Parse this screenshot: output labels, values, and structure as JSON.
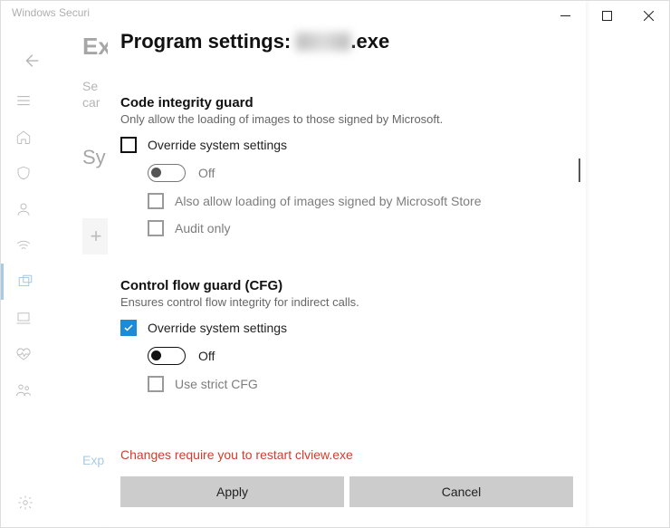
{
  "bg": {
    "appTitle": "Windows Securi",
    "heading": "Ex",
    "sub1": "Se",
    "sub2": "car",
    "section": "Sy",
    "link": "Exp"
  },
  "dialog": {
    "titlePrefix": "Program settings: ",
    "titleSuffix": ".exe",
    "sections": [
      {
        "title": "Code integrity guard",
        "desc": "Only allow the loading of images to those signed by Microsoft.",
        "override": "Override system settings",
        "overrideChecked": false,
        "toggleState": "Off",
        "toggleOn": false,
        "options": [
          "Also allow loading of images signed by Microsoft Store",
          "Audit only"
        ],
        "optionsChecked": [
          false,
          false
        ]
      },
      {
        "title": "Control flow guard (CFG)",
        "desc": "Ensures control flow integrity for indirect calls.",
        "override": "Override system settings",
        "overrideChecked": true,
        "toggleState": "Off",
        "toggleOn": false,
        "options": [
          "Use strict CFG"
        ],
        "optionsChecked": [
          false
        ]
      }
    ],
    "warning": "Changes require you to restart clview.exe",
    "buttons": {
      "apply": "Apply",
      "cancel": "Cancel"
    }
  }
}
